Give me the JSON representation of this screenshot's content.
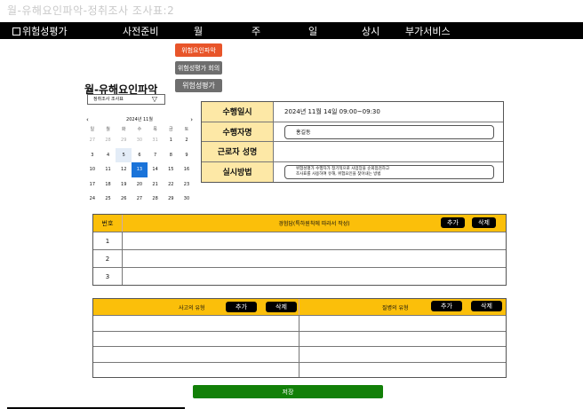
{
  "window": {
    "title": "월-유해요인파악-정취조사 조사표:2"
  },
  "nav": {
    "brand": "위험성평가",
    "items": [
      "사전준비",
      "월",
      "주",
      "일",
      "상시",
      "부가서비스"
    ]
  },
  "side_buttons": [
    {
      "label": "위험요인파악",
      "color": "#e8552a"
    },
    {
      "label": "위험성평가 회의",
      "color": "#6e6e6e"
    },
    {
      "label": "위험성평가",
      "color": "#6e6e6e"
    }
  ],
  "section": {
    "title": "월-유해요인파악"
  },
  "select": {
    "value": "정취조사 조사표",
    "arrow": "▽"
  },
  "calendar": {
    "title": "2024년 11월",
    "prev": "‹",
    "next": "›",
    "weekdays": [
      "일",
      "월",
      "화",
      "수",
      "목",
      "금",
      "토"
    ],
    "days": [
      [
        "27",
        "28",
        "29",
        "30",
        "31",
        "1",
        "2"
      ],
      [
        "3",
        "4",
        "5",
        "6",
        "7",
        "8",
        "9"
      ],
      [
        "10",
        "11",
        "12",
        "13",
        "14",
        "15",
        "16"
      ],
      [
        "17",
        "18",
        "19",
        "20",
        "21",
        "22",
        "23"
      ],
      [
        "24",
        "25",
        "26",
        "27",
        "28",
        "29",
        "30"
      ]
    ]
  },
  "info": {
    "date_label": "수행일시",
    "date_value": "2024년 11월 14일 09:00~09:30",
    "performer_label": "수행자명",
    "performer_value": "홍길동",
    "worker_label": "근로자 성명",
    "worker_value": "",
    "method_label": "실시방법",
    "method_line1": "위험성평가 수행자가 정기적으로 사업장을 순회점검하고",
    "method_line2": "조사표를 사용하여 유해, 위험요인을 찾아내는 방법"
  },
  "experience_table": {
    "no_header": "번호",
    "title": "경험담(특하원칙에 따라서 작성)",
    "add": "추가",
    "delete": "삭제",
    "rows": [
      "1",
      "2",
      "3"
    ]
  },
  "type_table": {
    "accident_label": "사고의 유형",
    "disease_label": "질병의 유형",
    "add": "추가",
    "delete": "삭제"
  },
  "save": {
    "label": "저장",
    "color": "#128008"
  },
  "colors": {
    "header_yellow": "#fbbf0a",
    "label_yellow": "#fde8a6",
    "selected_day": "#1a73d9"
  }
}
